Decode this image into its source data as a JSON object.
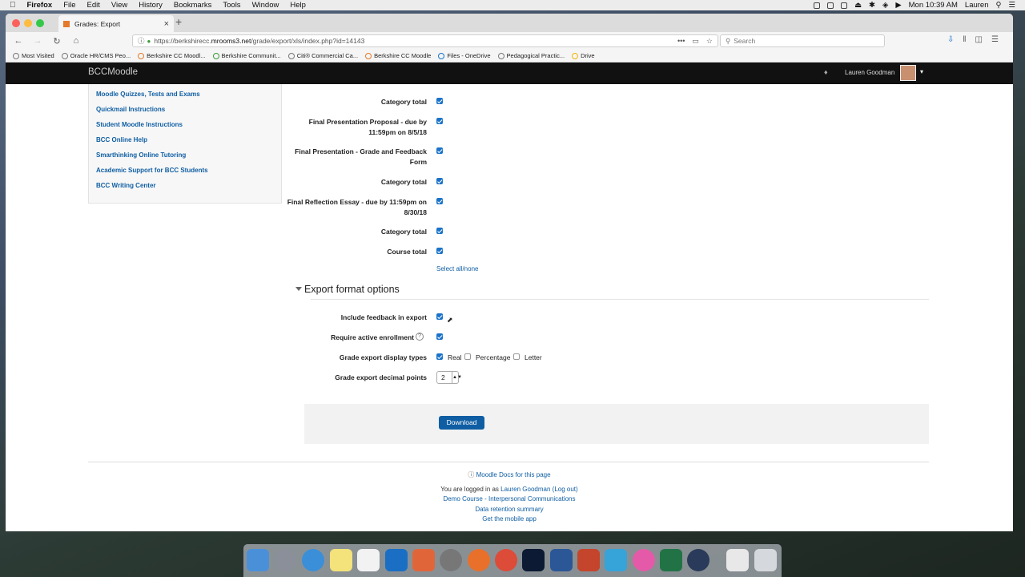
{
  "menubar": {
    "app": "Firefox",
    "items": [
      "File",
      "Edit",
      "View",
      "History",
      "Bookmarks",
      "Tools",
      "Window",
      "Help"
    ],
    "clock": "Mon 10:39 AM",
    "user": "Lauren"
  },
  "browser": {
    "tab_title": "Grades: Export",
    "url_prefix": "https://berkshirecc.",
    "url_domain": "mrooms3.net",
    "url_path": "/grade/export/xls/index.php?id=14143",
    "search_placeholder": "Search",
    "bookmarks": [
      "Most Visited",
      "Oracle HR/CMS Peo...",
      "Berkshire CC Moodl...",
      "Berkshire Communit...",
      "Citi® Commercial Ca...",
      "Berkshire CC Moodle",
      "Files - OneDrive",
      "Pedagogical Practic...",
      "Drive"
    ]
  },
  "moodle": {
    "brand": "BCCMoodle",
    "user_name": "Lauren Goodman"
  },
  "sidebar": {
    "links": [
      "Moodle Quizzes, Tests and Exams",
      "Quickmail Instructions",
      "Student Moodle Instructions",
      "BCC Online Help",
      "Smarthinking Online Tutoring",
      "Academic Support for BCC Students",
      "BCC Writing Center"
    ]
  },
  "grade_items": [
    "Category total",
    "Final Presentation Proposal - due by 11:59pm on 8/5/18",
    "Final Presentation - Grade and Feedback Form",
    "Category total",
    "Final Reflection Essay - due by 11:59pm on 8/30/18",
    "Category total",
    "Course total"
  ],
  "select_all": "Select all/none",
  "export_options": {
    "section_title": "Export format options",
    "include_feedback": "Include feedback in export",
    "require_active": "Require active enrollment",
    "display_types_label": "Grade export display types",
    "type_real": "Real",
    "type_percentage": "Percentage",
    "type_letter": "Letter",
    "decimal_label": "Grade export decimal points",
    "decimal_value": "2",
    "download": "Download"
  },
  "footer": {
    "docs": "Moodle Docs for this page",
    "logged_in_prefix": "You are logged in as",
    "logged_user": "Lauren Goodman",
    "logout": "(Log out)",
    "course": "Demo Course - Interpersonal Communications",
    "data_retention": "Data retention summary",
    "mobile_app": "Get the mobile app"
  }
}
